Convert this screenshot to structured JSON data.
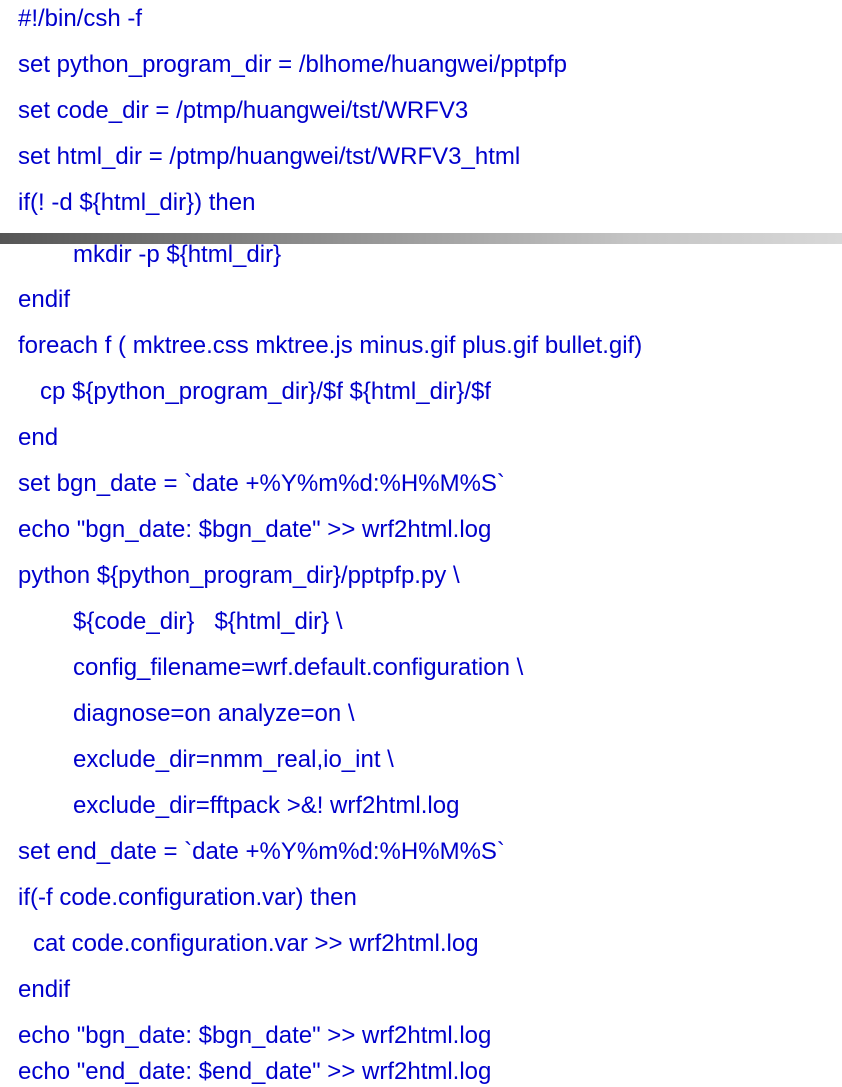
{
  "script": {
    "lines": [
      "#!/bin/csh -f",
      "set python_program_dir = /blhome/huangwei/pptpfp",
      "set code_dir = /ptmp/huangwei/tst/WRFV3",
      "set html_dir = /ptmp/huangwei/tst/WRFV3_html",
      "if(! -d ${html_dir}) then",
      "mkdir -p ${html_dir}",
      "endif",
      "foreach f ( mktree.css mktree.js minus.gif plus.gif bullet.gif)",
      "cp ${python_program_dir}/$f ${html_dir}/$f",
      "end",
      "set bgn_date = `date +%Y%m%d:%H%M%S`",
      "echo \"bgn_date: $bgn_date\" >> wrf2html.log",
      "python ${python_program_dir}/pptpfp.py \\",
      "${code_dir}   ${html_dir} \\",
      "config_filename=wrf.default.configuration \\",
      "diagnose=on analyze=on \\",
      "exclude_dir=nmm_real,io_int \\",
      "exclude_dir=fftpack >&! wrf2html.log",
      "set end_date = `date +%Y%m%d:%H%M%S`",
      "if(-f code.configuration.var) then",
      "cat code.configuration.var >> wrf2html.log",
      "endif",
      "echo \"bgn_date: $bgn_date\" >> wrf2html.log",
      "echo \"end_date: $end_date\" >> wrf2html.log"
    ]
  },
  "colors": {
    "text": "#0000cc",
    "background": "#ffffff",
    "bar_dark": "#555555",
    "bar_light": "#d8d8d8"
  }
}
